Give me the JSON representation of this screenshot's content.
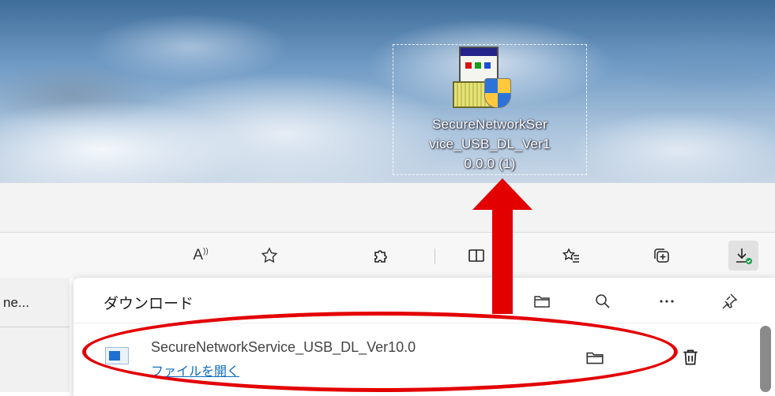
{
  "desktop": {
    "icon": {
      "name": "installer-shield-icon",
      "label_lines": [
        "SecureNetworkSer",
        "vice_USB_DL_Ver1",
        "0.0.0 (1)"
      ]
    }
  },
  "toolbar": {
    "buttons": [
      {
        "name": "read-aloud-icon",
        "glyph": "A⁾"
      },
      {
        "name": "favorite-star-icon"
      },
      {
        "name": "extensions-puzzle-icon"
      },
      {
        "name": "split-screen-icon"
      },
      {
        "name": "favorites-list-icon"
      },
      {
        "name": "collections-icon"
      },
      {
        "name": "downloads-icon",
        "active": true
      }
    ]
  },
  "tab_strip": {
    "snippet": "ne..."
  },
  "downloads": {
    "title": "ダウンロード",
    "item": {
      "file_name": "SecureNetworkService_USB_DL_Ver10.0",
      "open_link": "ファイルを開く"
    }
  },
  "annotations": {
    "color": "#e30000"
  }
}
